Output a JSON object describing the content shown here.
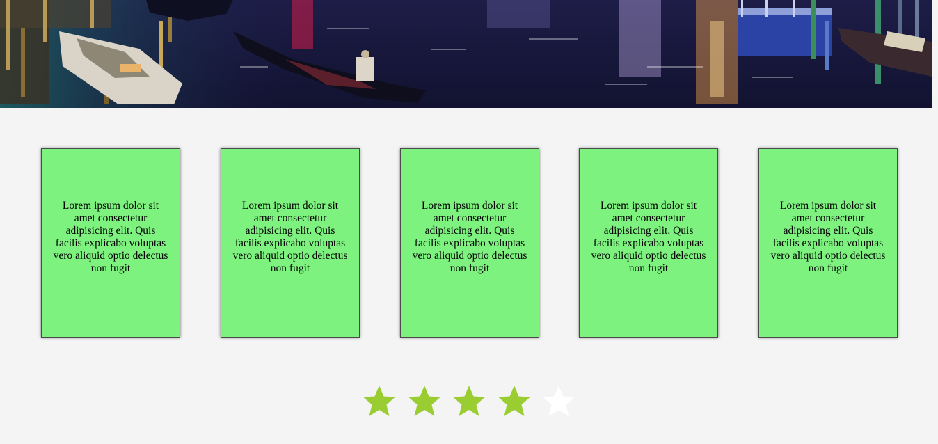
{
  "hero": {
    "image_icon": "venice-canal-night-photo"
  },
  "cards": [
    {
      "text": "Lorem ipsum dolor sit amet consectetur adipisicing elit. Quis facilis explicabo voluptas vero aliquid optio delectus non fugit"
    },
    {
      "text": "Lorem ipsum dolor sit amet consectetur adipisicing elit. Quis facilis explicabo voluptas vero aliquid optio delectus non fugit"
    },
    {
      "text": "Lorem ipsum dolor sit amet consectetur adipisicing elit. Quis facilis explicabo voluptas vero aliquid optio delectus non fugit"
    },
    {
      "text": "Lorem ipsum dolor sit amet consectetur adipisicing elit. Quis facilis explicabo voluptas vero aliquid optio delectus non fugit"
    },
    {
      "text": "Lorem ipsum dolor sit amet consectetur adipisicing elit. Quis facilis explicabo voluptas vero aliquid optio delectus non fugit"
    }
  ],
  "rating": {
    "value": 4,
    "max": 5,
    "icon": "star-icon",
    "active_color": "#9acd32",
    "inactive_color": "#ffffff"
  },
  "colors": {
    "card_background": "#7df27f",
    "page_background": "#f4f4f4"
  }
}
